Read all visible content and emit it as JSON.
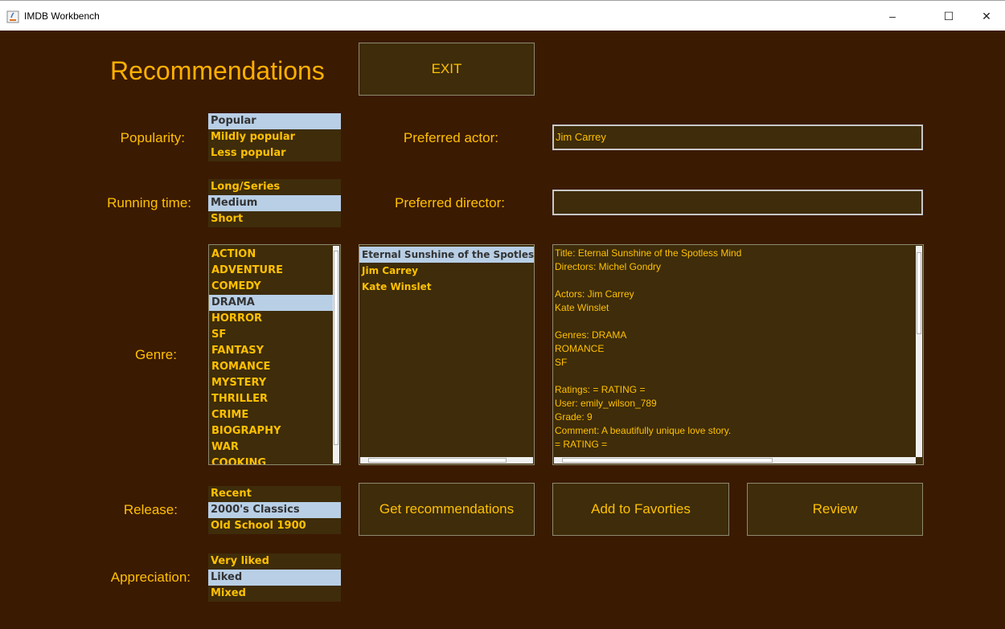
{
  "window": {
    "title": "IMDB Workbench",
    "minimize": "–",
    "maximize": "☐",
    "close": "✕"
  },
  "page": {
    "heading": "Recommendations",
    "exit_label": "EXIT"
  },
  "labels": {
    "popularity": "Popularity:",
    "running_time": "Running time:",
    "genre": "Genre:",
    "release": "Release:",
    "appreciation": "Appreciation:",
    "preferred_actor": "Preferred actor:",
    "preferred_director": "Preferred director:"
  },
  "popularity": {
    "options": [
      "Popular",
      "Mildly popular",
      "Less popular"
    ],
    "selected": "Popular"
  },
  "running_time": {
    "options": [
      "Long/Series",
      "Medium",
      "Short"
    ],
    "selected": "Medium"
  },
  "genre": {
    "options": [
      "ACTION",
      "ADVENTURE",
      "COMEDY",
      "DRAMA",
      "HORROR",
      "SF",
      "FANTASY",
      "ROMANCE",
      "MYSTERY",
      "THRILLER",
      "CRIME",
      "BIOGRAPHY",
      "WAR",
      "COOKING"
    ],
    "selected": "DRAMA"
  },
  "release": {
    "options": [
      "Recent",
      "2000's Classics",
      "Old School 1900"
    ],
    "selected": "2000's Classics"
  },
  "appreciation": {
    "options": [
      "Very liked",
      "Liked",
      "Mixed"
    ],
    "selected": "Liked"
  },
  "fields": {
    "preferred_actor": "Jim Carrey",
    "preferred_director": ""
  },
  "results": {
    "items": [
      "Eternal Sunshine of the Spotless Mind",
      "Jim Carrey",
      "Kate Winslet"
    ],
    "selected": "Eternal Sunshine of the Spotless Mind"
  },
  "details": {
    "lines": [
      "Title: Eternal Sunshine of the Spotless Mind",
      "Directors: Michel Gondry",
      "",
      "Actors: Jim Carrey",
      "Kate Winslet",
      "",
      "Genres: DRAMA",
      "ROMANCE",
      "SF",
      "",
      "Ratings: = RATING =",
      "User: emily_wilson_789",
      "Grade: 9",
      "Comment: A beautifully unique love story.",
      "= RATING ="
    ]
  },
  "actions": {
    "get_recommendations": "Get recommendations",
    "add_favorites": "Add to Favorties",
    "review": "Review"
  },
  "colors": {
    "background": "#3b1a02",
    "panel": "#3e2c0a",
    "accent": "#ffc100",
    "selection": "#b8cfe6"
  }
}
